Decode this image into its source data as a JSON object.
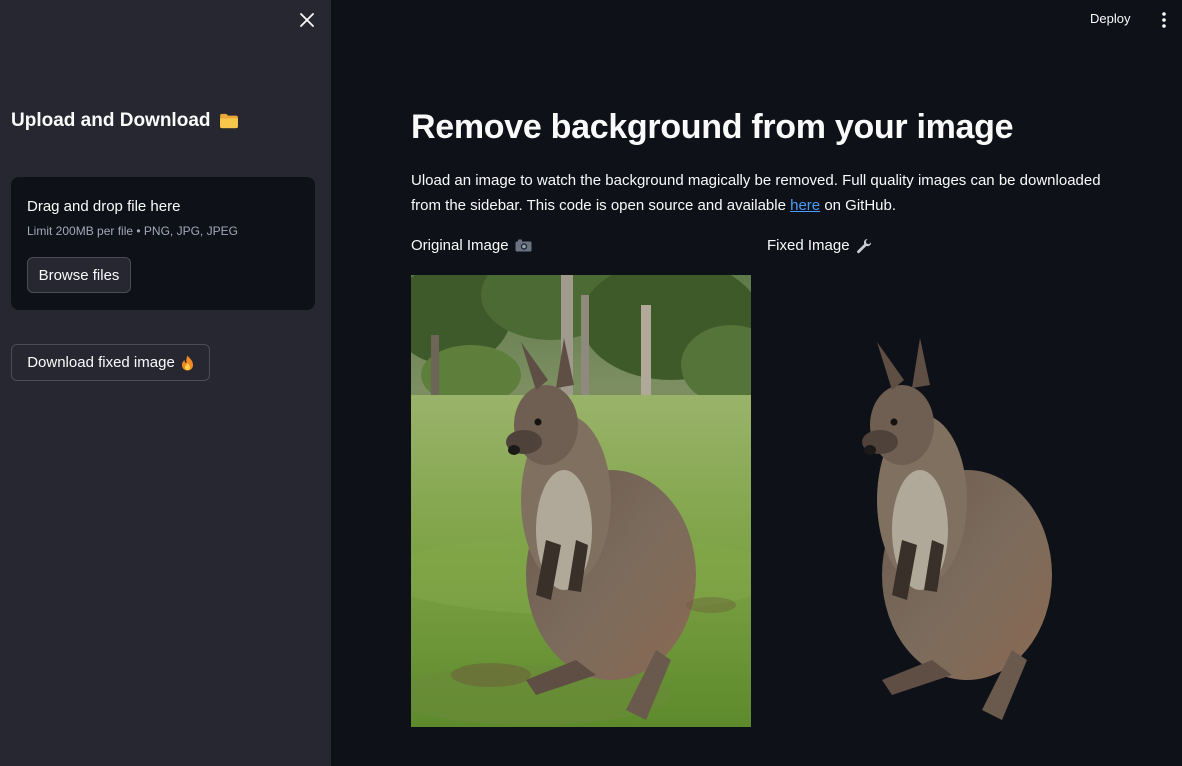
{
  "sidebar": {
    "close_icon": "close-icon",
    "heading": "Upload and Download",
    "heading_icon": "folder-icon",
    "uploader": {
      "title": "Drag and drop file here",
      "limit": "Limit 200MB per file • PNG, JPG, JPEG",
      "browse_label": "Browse files"
    },
    "download_label": "Download fixed image",
    "download_icon": "fire-icon"
  },
  "header": {
    "deploy_label": "Deploy",
    "menu_icon": "more-vertical-icon"
  },
  "main": {
    "title": "Remove background from your image",
    "description_pre": "Uload an image to watch the background magically be removed. Full quality images can be downloaded from the sidebar. This code is open source and available ",
    "description_link": "here",
    "description_post": " on GitHub.",
    "columns": [
      {
        "label": "Original Image",
        "icon": "camera-icon"
      },
      {
        "label": "Fixed Image",
        "icon": "wrench-icon"
      }
    ]
  },
  "colors": {
    "background": "#0e1117",
    "sidebar": "#262730",
    "link": "#4b9cff",
    "text": "#fafafa"
  }
}
